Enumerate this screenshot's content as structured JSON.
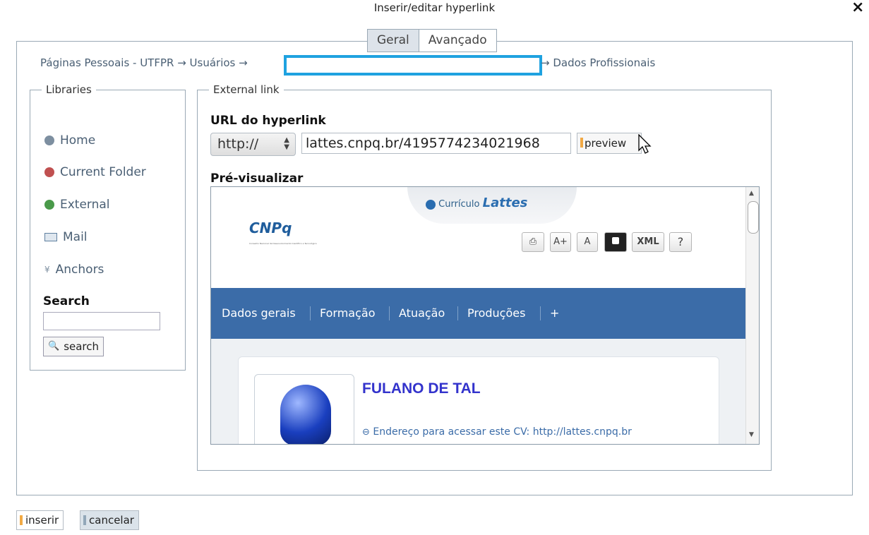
{
  "dialog": {
    "title": "Inserir/editar hyperlink",
    "close": "×"
  },
  "tabs": [
    {
      "label": "Geral"
    },
    {
      "label": "Avançado"
    }
  ],
  "breadcrumb": {
    "head": "Páginas Pessoais - UTFPR → Usuários →",
    "tail": "→ Dados Profissionais"
  },
  "libraries": {
    "legend": "Libraries",
    "items": [
      {
        "label": "Home",
        "icon": "home-icon",
        "color": "#7d8fa0"
      },
      {
        "label": "Current Folder",
        "icon": "folder-icon",
        "color": "#c05050"
      },
      {
        "label": "External",
        "icon": "globe-icon",
        "color": "#4a9a4a"
      },
      {
        "label": "Mail",
        "icon": "mail-icon",
        "color": "#6080a0"
      },
      {
        "label": "Anchors",
        "icon": "anchor-icon",
        "color": "#7d8fa0"
      }
    ],
    "search": {
      "label": "Search",
      "button": "search",
      "value": ""
    }
  },
  "external": {
    "legend": "External link",
    "url_label": "URL do hyperlink",
    "scheme": "http://",
    "url_value": "lattes.cnpq.br/4195774234021968",
    "preview_button": "preview",
    "preview_label": "Pré-visualizar"
  },
  "preview_page": {
    "banner_prefix": "Currículo",
    "banner_main": "Lattes",
    "logo": "CNPq",
    "logo_sub": "Conselho Nacional de Desenvolvimento Científico e Tecnológico",
    "tools": [
      "A+",
      "A",
      "XML",
      "?"
    ],
    "nav": [
      "Dados gerais",
      "Formação",
      "Atuação",
      "Produções",
      "+"
    ],
    "person_name": "FULANO DE TAL",
    "cv_url": "Endereço para acessar este CV: http://lattes.cnpq.br"
  },
  "footer": {
    "insert": "inserir",
    "cancel": "cancelar"
  },
  "colors": {
    "accent_box": "#1fa2e0",
    "nav_bg": "#3b6ca8",
    "name": "#3333cc"
  }
}
